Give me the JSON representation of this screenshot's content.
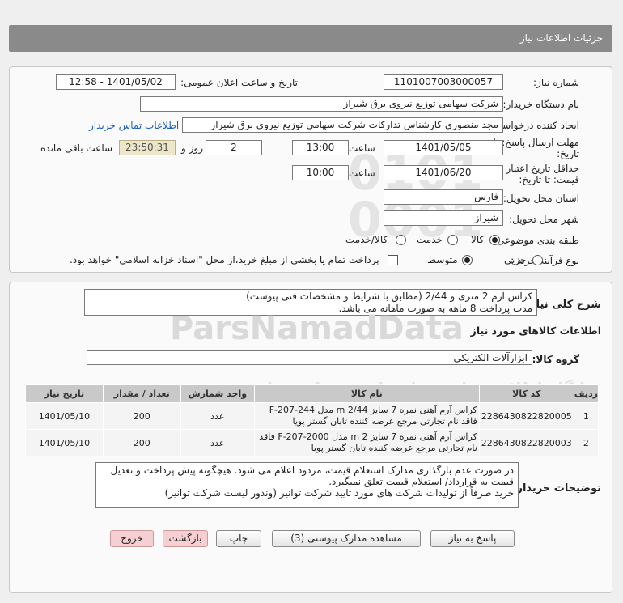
{
  "header": {
    "title": "جزئیات اطلاعات نیاز"
  },
  "form": {
    "need_number_label": "شماره نیاز:",
    "need_number": "1101007003000057",
    "announce_label": "تاریخ و ساعت اعلان عمومی:",
    "announce_value": "1401/05/02 - 12:58",
    "buyer_label": "نام دستگاه خریدار:",
    "buyer_value": "شرکت سهامی توزیع نیروی برق شیراز",
    "creator_label": "ایجاد کننده درخواست:",
    "creator_value": "مجد منصوری کارشناس تدارکات شرکت سهامی توزیع نیروی برق شیراز",
    "contact_link": "اطلاعات تماس خریدار",
    "deadline_label_1": "مهلت ارسال پاسخ: تا",
    "deadline_label_2": "تاریخ:",
    "deadline_date": "1401/05/05",
    "time_label": "ساعت",
    "deadline_time": "13:00",
    "days_value": "2",
    "days_label": "روز و",
    "remaining_time": "23:50:31",
    "remaining_label": "ساعت باقی مانده",
    "validity_label_1": "حداقل تاریخ اعتبار",
    "validity_label_2": "قیمت: تا تاریخ:",
    "validity_date": "1401/06/20",
    "validity_time_label": "ساعت",
    "validity_time": "10:00",
    "province_label": "استان محل تحویل:",
    "province_value": "فارس",
    "city_label": "شهر محل تحویل:",
    "city_value": "شیراز",
    "category_label": "طبقه بندی موضوعی:",
    "category_options": [
      "کالا",
      "خدمت",
      "کالا/خدمت"
    ],
    "process_label": "نوع فرآیند خرید :",
    "process_options": [
      "جزیی",
      "متوسط"
    ],
    "payment_note": "پرداخت تمام یا بخشی از مبلغ خرید،از محل \"اسناد خزانه اسلامی\" خواهد بود."
  },
  "summary": {
    "label": "شرح کلی نیاز:",
    "line1": "کراس آرم 2 متری و 2/44 (مطابق با شرایط و مشخصات فنی پیوست)",
    "line2": "مدت پرداخت 8 ماهه به صورت ماهانه می باشد."
  },
  "goods": {
    "section_title": "اطلاعات کالاهای مورد نیاز",
    "group_label": "گروه کالا:",
    "group_value": "ابزارآلات الکتریکی",
    "columns": [
      "ردیف",
      "کد کالا",
      "نام کالا",
      "واحد شمارش",
      "تعداد / مقدار",
      "تاریخ نیاز"
    ],
    "rows": [
      {
        "idx": "1",
        "code": "2286430822820005",
        "name": "کراس آرم آهنی نمره 7 سایز 2/44 m مدل F-207-244 فاقد نام تجارتی مرجع عرضه کننده تابان گستر پویا",
        "unit": "عدد",
        "qty": "200",
        "date": "1401/05/10"
      },
      {
        "idx": "2",
        "code": "2286430822820003",
        "name": "کراس آرم آهنی نمره 7 سایز 2 m مدل F-207-2000 فاقد نام تجارتی مرجع عرضه کننده تابان گستر پویا",
        "unit": "عدد",
        "qty": "200",
        "date": "1401/05/10"
      }
    ]
  },
  "buyer_notes": {
    "label": "توضیحات خریدار:",
    "line1": "در صورت عدم بارگذاری مدارک استعلام قیمت، مردود اعلام می شود. هیچگونه پیش پرداخت و تعدیل",
    "line2": "قیمت به قرارداد/ استعلام قیمت تعلق نمیگیرد.",
    "line3": "خرید صرفاً از تولیدات شرکت های مورد تایید شرکت توانیر (وندور لیست شرکت توانیر)"
  },
  "buttons": {
    "reply": "پاسخ به نیاز",
    "attachments": "مشاهده مدارک پیوستی (3)",
    "print": "چاپ",
    "back": "بازگشت",
    "exit": "خروج"
  },
  "watermark": {
    "text": "ParsNamadData",
    "sub": "پایگاه اطلاع رسانی مناقصات و مزایده ها",
    "phone": "021-88349670"
  }
}
